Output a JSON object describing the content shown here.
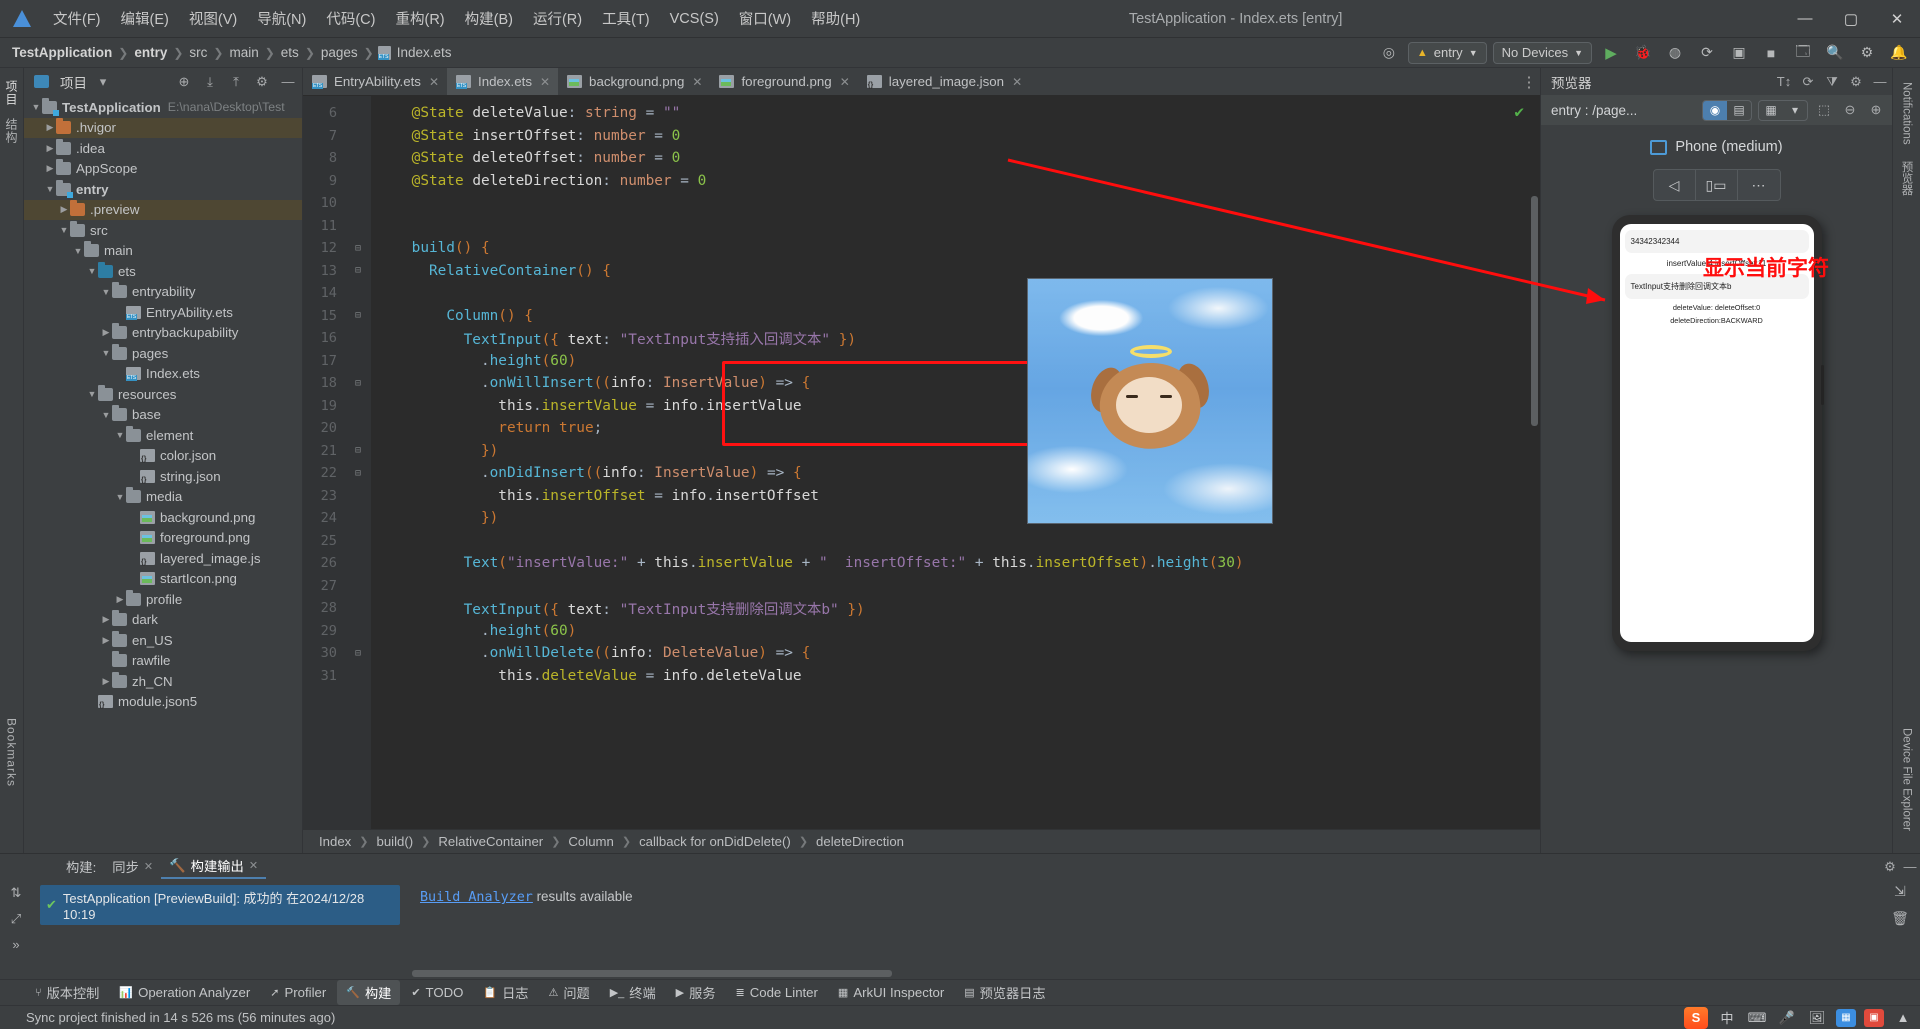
{
  "titlebar": {
    "menus": [
      "文件(F)",
      "编辑(E)",
      "视图(V)",
      "导航(N)",
      "代码(C)",
      "重构(R)",
      "构建(B)",
      "运行(R)",
      "工具(T)",
      "VCS(S)",
      "窗口(W)",
      "帮助(H)"
    ],
    "window_title": "TestApplication - Index.ets [entry]",
    "minimize": "—",
    "maximize": "▢",
    "close": "✕"
  },
  "navbar": {
    "crumbs": [
      "TestApplication",
      "entry",
      "src",
      "main",
      "ets",
      "pages",
      "Index.ets"
    ],
    "target_module": "entry",
    "device": "No Devices",
    "icons": [
      "target-icon",
      "run-icon",
      "debug-icon",
      "profile-icon",
      "rerun-icon",
      "coverage-icon",
      "stop-icon",
      "device-manager-icon",
      "search-icon",
      "settings-icon",
      "notifications-icon"
    ]
  },
  "leftstrip": {
    "tabs": [
      "项目",
      "结构"
    ],
    "bookmarks": "Bookmarks"
  },
  "project": {
    "title": "项目",
    "tools": [
      "locate-icon",
      "collapse-all-icon",
      "expand-icon",
      "settings-icon",
      "hide-icon"
    ],
    "tree": [
      {
        "label": "TestApplication",
        "sub": "E:\\nana\\Desktop\\Test",
        "depth": 0,
        "arrow": "v",
        "icon": "folder-module",
        "bold": true,
        "state": "normal"
      },
      {
        "label": ".hvigor",
        "depth": 1,
        "arrow": ">",
        "icon": "folder-orange",
        "state": "hl"
      },
      {
        "label": ".idea",
        "depth": 1,
        "arrow": ">",
        "icon": "folder",
        "state": "normal"
      },
      {
        "label": "AppScope",
        "depth": 1,
        "arrow": ">",
        "icon": "folder",
        "state": "normal"
      },
      {
        "label": "entry",
        "depth": 1,
        "arrow": "v",
        "icon": "folder-module",
        "bold": true,
        "state": "normal"
      },
      {
        "label": ".preview",
        "depth": 2,
        "arrow": ">",
        "icon": "folder-orange",
        "state": "hl"
      },
      {
        "label": "src",
        "depth": 2,
        "arrow": "v",
        "icon": "folder",
        "state": "normal"
      },
      {
        "label": "main",
        "depth": 3,
        "arrow": "v",
        "icon": "folder",
        "state": "normal"
      },
      {
        "label": "ets",
        "depth": 4,
        "arrow": "v",
        "icon": "folder-blue",
        "state": "normal"
      },
      {
        "label": "entryability",
        "depth": 5,
        "arrow": "v",
        "icon": "folder",
        "state": "normal"
      },
      {
        "label": "EntryAbility.ets",
        "depth": 6,
        "arrow": "",
        "icon": "file-ets",
        "state": "normal"
      },
      {
        "label": "entrybackupability",
        "depth": 5,
        "arrow": ">",
        "icon": "folder",
        "state": "normal"
      },
      {
        "label": "pages",
        "depth": 5,
        "arrow": "v",
        "icon": "folder",
        "state": "normal"
      },
      {
        "label": "Index.ets",
        "depth": 6,
        "arrow": "",
        "icon": "file-ets",
        "state": "normal"
      },
      {
        "label": "resources",
        "depth": 4,
        "arrow": "v",
        "icon": "folder",
        "state": "normal"
      },
      {
        "label": "base",
        "depth": 5,
        "arrow": "v",
        "icon": "folder",
        "state": "normal"
      },
      {
        "label": "element",
        "depth": 6,
        "arrow": "v",
        "icon": "folder",
        "state": "normal"
      },
      {
        "label": "color.json",
        "depth": 7,
        "arrow": "",
        "icon": "file-json",
        "state": "normal"
      },
      {
        "label": "string.json",
        "depth": 7,
        "arrow": "",
        "icon": "file-json",
        "state": "normal"
      },
      {
        "label": "media",
        "depth": 6,
        "arrow": "v",
        "icon": "folder",
        "state": "normal"
      },
      {
        "label": "background.png",
        "depth": 7,
        "arrow": "",
        "icon": "file-png",
        "state": "normal"
      },
      {
        "label": "foreground.png",
        "depth": 7,
        "arrow": "",
        "icon": "file-png",
        "state": "normal"
      },
      {
        "label": "layered_image.js",
        "depth": 7,
        "arrow": "",
        "icon": "file-json",
        "state": "normal"
      },
      {
        "label": "startIcon.png",
        "depth": 7,
        "arrow": "",
        "icon": "file-png",
        "state": "normal"
      },
      {
        "label": "profile",
        "depth": 6,
        "arrow": ">",
        "icon": "folder",
        "state": "normal"
      },
      {
        "label": "dark",
        "depth": 5,
        "arrow": ">",
        "icon": "folder",
        "state": "normal"
      },
      {
        "label": "en_US",
        "depth": 5,
        "arrow": ">",
        "icon": "folder",
        "state": "normal"
      },
      {
        "label": "rawfile",
        "depth": 5,
        "arrow": "",
        "icon": "folder",
        "state": "normal"
      },
      {
        "label": "zh_CN",
        "depth": 5,
        "arrow": ">",
        "icon": "folder",
        "state": "normal"
      },
      {
        "label": "module.json5",
        "depth": 4,
        "arrow": "",
        "icon": "file-json",
        "state": "normal"
      }
    ]
  },
  "editor": {
    "tabs": [
      {
        "label": "EntryAbility.ets",
        "icon": "file-ets",
        "active": false
      },
      {
        "label": "Index.ets",
        "icon": "file-ets",
        "active": true
      },
      {
        "label": "background.png",
        "icon": "file-png",
        "active": false
      },
      {
        "label": "foreground.png",
        "icon": "file-png",
        "active": false
      },
      {
        "label": "layered_image.json",
        "icon": "file-json",
        "active": false
      }
    ],
    "inspection_ok": "✔",
    "lines": [
      {
        "n": 6,
        "fold": "",
        "html": "    <span class='at'>@State</span> <span class='white'>deleteValue</span><span class='punc'>:</span> <span class='pr'>string</span> <span class='punc'>=</span> <span class='str2'>\"\"</span>"
      },
      {
        "n": 7,
        "fold": "",
        "html": "    <span class='at'>@State</span> <span class='white'>insertOffset</span><span class='punc'>:</span> <span class='pr'>number</span> <span class='punc'>=</span> <span class='num'>0</span>"
      },
      {
        "n": 8,
        "fold": "",
        "html": "    <span class='at'>@State</span> <span class='white'>deleteOffset</span><span class='punc'>:</span> <span class='pr'>number</span> <span class='punc'>=</span> <span class='num'>0</span>"
      },
      {
        "n": 9,
        "fold": "",
        "html": "    <span class='at'>@State</span> <span class='white'>deleteDirection</span><span class='punc'>:</span> <span class='pr'>number</span> <span class='punc'>=</span> <span class='num'>0</span>"
      },
      {
        "n": 10,
        "fold": "",
        "html": ""
      },
      {
        "n": 11,
        "fold": "",
        "html": ""
      },
      {
        "n": 12,
        "fold": "⊟",
        "html": "    <span class='comp'>build</span><span class='br1'>()</span> <span class='br1'>{</span>"
      },
      {
        "n": 13,
        "fold": "⊟",
        "html": "      <span class='comp'>RelativeContainer</span><span class='br1'>()</span> <span class='br1'>{</span>"
      },
      {
        "n": 14,
        "fold": "",
        "html": ""
      },
      {
        "n": 15,
        "fold": "⊟",
        "html": "        <span class='comp'>Column</span><span class='br1'>()</span> <span class='br1'>{</span>"
      },
      {
        "n": 16,
        "fold": "",
        "html": "          <span class='comp'>TextInput</span><span class='br1'>({</span> <span class='white'>text</span><span class='punc'>:</span> <span class='str2'>\"TextInput支持插入回调文本\"</span> <span class='br1'>})</span>"
      },
      {
        "n": 17,
        "fold": "",
        "html": "            <span class='punc'>.</span><span class='comp'>height</span><span class='br1'>(</span><span class='num'>60</span><span class='br1'>)</span>"
      },
      {
        "n": 18,
        "fold": "⊟",
        "html": "            <span class='punc'>.</span><span class='comp'>onWillInsert</span><span class='br1'>((</span><span class='white'>info</span><span class='punc'>:</span> <span class='pr'>InsertValue</span><span class='br1'>)</span> <span class='punc'>=&gt;</span> <span class='br1'>{</span>"
      },
      {
        "n": 19,
        "fold": "",
        "html": "              <span class='white'>this</span><span class='punc'>.</span><span class='at'>insertValue</span> <span class='punc'>=</span> <span class='white'>info</span><span class='punc'>.</span><span class='white'>insertValue</span>"
      },
      {
        "n": 20,
        "fold": "",
        "html": "              <span class='k'>return</span> <span class='k'>true</span><span class='punc'>;</span>"
      },
      {
        "n": 21,
        "fold": "⊟",
        "html": "            <span class='br1'>})</span>"
      },
      {
        "n": 22,
        "fold": "⊟",
        "html": "            <span class='punc'>.</span><span class='comp'>onDidInsert</span><span class='br1'>((</span><span class='white'>info</span><span class='punc'>:</span> <span class='pr'>InsertValue</span><span class='br1'>)</span> <span class='punc'>=&gt;</span> <span class='br1'>{</span>"
      },
      {
        "n": 23,
        "fold": "",
        "html": "              <span class='white'>this</span><span class='punc'>.</span><span class='at'>insertOffset</span> <span class='punc'>=</span> <span class='white'>info</span><span class='punc'>.</span><span class='white'>insertOffset</span>"
      },
      {
        "n": 24,
        "fold": "",
        "html": "            <span class='br1'>})</span>"
      },
      {
        "n": 25,
        "fold": "",
        "html": ""
      },
      {
        "n": 26,
        "fold": "",
        "html": "          <span class='comp'>Text</span><span class='br1'>(</span><span class='str2'>\"insertValue:\"</span> <span class='punc'>+</span> <span class='white'>this</span><span class='punc'>.</span><span class='at'>insertValue</span> <span class='punc'>+</span> <span class='str2'>\"  insertOffset:\"</span> <span class='punc'>+</span> <span class='white'>this</span><span class='punc'>.</span><span class='at'>insertOffset</span><span class='br1'>)</span><span class='punc'>.</span><span class='comp'>height</span><span class='br1'>(</span><span class='num'>30</span><span class='br1'>)</span>"
      },
      {
        "n": 27,
        "fold": "",
        "html": ""
      },
      {
        "n": 28,
        "fold": "",
        "html": "          <span class='comp'>TextInput</span><span class='br1'>({</span> <span class='white'>text</span><span class='punc'>:</span> <span class='str2'>\"TextInput支持删除回调文本b\"</span> <span class='br1'>})</span>"
      },
      {
        "n": 29,
        "fold": "",
        "html": "            <span class='punc'>.</span><span class='comp'>height</span><span class='br1'>(</span><span class='num'>60</span><span class='br1'>)</span>"
      },
      {
        "n": 30,
        "fold": "⊟",
        "html": "            <span class='punc'>.</span><span class='comp'>onWillDelete</span><span class='br1'>((</span><span class='white'>info</span><span class='punc'>:</span> <span class='pr'>DeleteValue</span><span class='br1'>)</span> <span class='punc'>=&gt;</span> <span class='br1'>{</span>"
      },
      {
        "n": 31,
        "fold": "",
        "html": "              <span class='white'>this</span><span class='punc'>.</span><span class='at'>deleteValue</span> <span class='punc'>=</span> <span class='white'>info</span><span class='punc'>.</span><span class='white'>deleteValue</span>"
      }
    ],
    "breadcrumb": [
      "Index",
      "build()",
      "RelativeContainer",
      "Column",
      "callback for onDidDelete()",
      "deleteDirection"
    ]
  },
  "preview": {
    "title": "预览器",
    "header_icons": [
      "font-size-icon",
      "refresh-icon",
      "filter-icon",
      "settings-icon",
      "minimize-icon"
    ],
    "page_name": "entry : /page...",
    "toolbar_icons": [
      "eye-icon",
      "layers-icon",
      "grid-icon",
      "chevron-down-icon",
      "frame-icon",
      "zoom-out-icon",
      "zoom-in-icon"
    ],
    "device_label": "Phone (medium)",
    "nav_buttons": [
      "back-icon",
      "rotate-icon",
      "more-icon"
    ],
    "screen": {
      "field1_value": "34342342344",
      "info_line1": "insertValue:4  insertOffset:11",
      "field2_value": "TextInput支持删除回调文本b",
      "info_line2": "deleteValue:  deleteOffset:0",
      "info_line3": "deleteDirection:BACKWARD"
    },
    "annotation": "显示当前字符"
  },
  "rightstrip": {
    "tabs": [
      "Notifications",
      "预览器",
      "Device File Explorer"
    ]
  },
  "bottom": {
    "tabs": [
      {
        "label": "构建:",
        "closable": false,
        "on": false
      },
      {
        "label": "同步",
        "closable": true,
        "on": false
      },
      {
        "label": "构建输出",
        "closable": true,
        "on": true
      }
    ],
    "build_status": "TestApplication [PreviewBuild]: 成功的 在2024/12/28 10:19",
    "output_link": "Build Analyzer",
    "output_text": " results available",
    "icons": [
      "filter-icon",
      "expand-icon",
      "collapse-icon"
    ],
    "right_icons": [
      "settings-icon",
      "minimize-icon",
      "wrap-icon",
      "clear-icon"
    ]
  },
  "toolwindows": [
    {
      "label": "版本控制",
      "icon": "vcs-icon",
      "on": false
    },
    {
      "label": "Operation Analyzer",
      "icon": "chart-icon",
      "on": false
    },
    {
      "label": "Profiler",
      "icon": "profiler-icon",
      "on": false
    },
    {
      "label": "构建",
      "icon": "hammer-icon",
      "on": true
    },
    {
      "label": "TODO",
      "icon": "todo-icon",
      "on": false
    },
    {
      "label": "日志",
      "icon": "log-icon",
      "on": false
    },
    {
      "label": "问题",
      "icon": "problems-icon",
      "on": false
    },
    {
      "label": "终端",
      "icon": "terminal-icon",
      "on": false
    },
    {
      "label": "服务",
      "icon": "services-icon",
      "on": false
    },
    {
      "label": "Code Linter",
      "icon": "linter-icon",
      "on": false
    },
    {
      "label": "ArkUI Inspector",
      "icon": "inspector-icon",
      "on": false
    },
    {
      "label": "预览器日志",
      "icon": "preview-log-icon",
      "on": false
    }
  ],
  "statusbar": {
    "message": "Sync project finished in 14 s 526 ms (56 minutes ago)",
    "tray": [
      "sogou-icon",
      "chinese-mode",
      "keyboard-icon",
      "mic-icon",
      "image-icon",
      "panel-icon",
      "screenshot-icon",
      "chevron-up-icon"
    ],
    "ime_label": "中"
  },
  "colors": {
    "accent": "#4d7fae",
    "annotation_red": "#ff0d0d",
    "success_green": "#53b04a",
    "link_blue": "#589df6",
    "panel_bg": "#3c3f41",
    "editor_bg": "#2b2b2b"
  }
}
